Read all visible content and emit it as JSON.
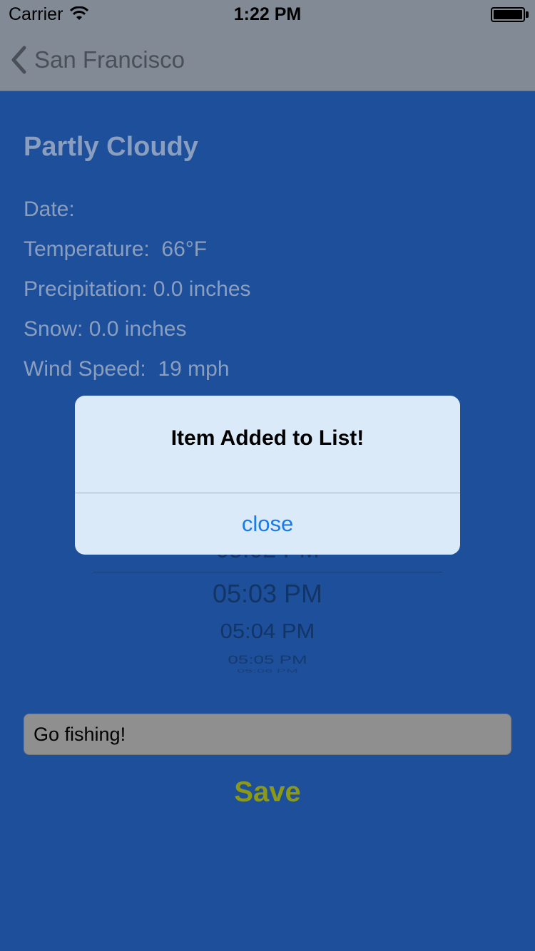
{
  "status_bar": {
    "carrier": "Carrier",
    "time": "1:22 PM"
  },
  "nav": {
    "back_label": "San Francisco"
  },
  "weather": {
    "title": "Partly Cloudy",
    "date": "Date:",
    "temperature": "Temperature:  66°F",
    "precipitation": "Precipitation: 0.0 inches",
    "snow": "Snow: 0.0 inches",
    "wind": "Wind Speed:  19 mph"
  },
  "picker": {
    "rows": [
      "05:02 PM",
      "05:03 PM",
      "05:04 PM",
      "05:05 PM",
      "05:06 PM"
    ]
  },
  "task_input": {
    "value": "Go fishing!"
  },
  "save_label": "Save",
  "alert": {
    "title": "Item Added to List!",
    "close_label": "close"
  },
  "colors": {
    "accent_save": "#8c9914",
    "background": "#1e4f9b",
    "alert_button": "#1a7ae8"
  }
}
